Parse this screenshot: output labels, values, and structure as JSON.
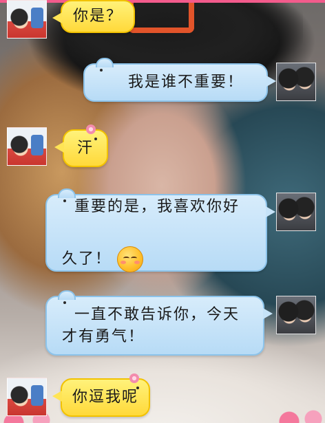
{
  "chat": {
    "messages": [
      {
        "side": "left",
        "text": "你是？",
        "bubble_color": "#ffe455"
      },
      {
        "side": "right",
        "text": "我是谁不重要！",
        "bubble_color": "#c6e3f8"
      },
      {
        "side": "left",
        "text": "汗",
        "bubble_color": "#ffe455"
      },
      {
        "side": "right",
        "line1": "重要的是，我喜欢你好",
        "line2": "久了！",
        "emoji": "blushing-face-emoji",
        "bubble_color": "#c6e3f8"
      },
      {
        "side": "right",
        "line1": "一直不敢告诉你，今天",
        "line2": "才有勇气！",
        "bubble_color": "#c6e3f8"
      },
      {
        "side": "left",
        "text": "你逗我呢",
        "bubble_color": "#ffe455"
      }
    ]
  },
  "colors": {
    "blue_bubble": "#c6e3f8",
    "yellow_bubble": "#ffe455",
    "accent_pink": "#f35b8c"
  }
}
